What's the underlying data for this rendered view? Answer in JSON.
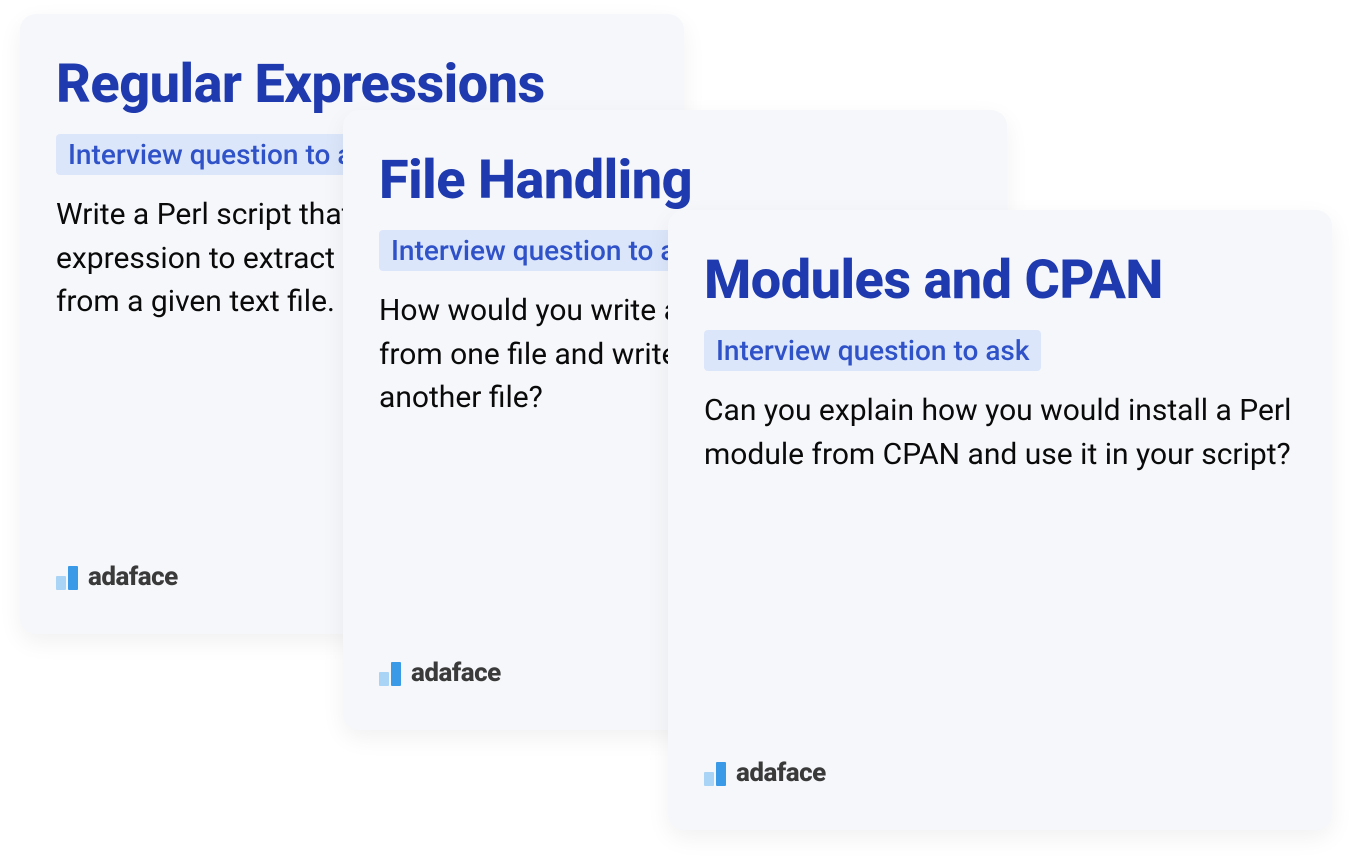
{
  "cards": [
    {
      "title": "Regular Expressions",
      "badge": "Interview question to ask",
      "body": "Write a Perl script that uses a regular expression to extract all email addresses from a given text file."
    },
    {
      "title": "File Handling",
      "badge": "Interview question to ask",
      "body": "How would you write a Perl script to read from one file and write the contents to another file?"
    },
    {
      "title": "Modules and CPAN",
      "badge": "Interview question to ask",
      "body": "Can you explain how you would install a Perl module from CPAN and use it in your script?"
    }
  ],
  "brand": "adaface"
}
